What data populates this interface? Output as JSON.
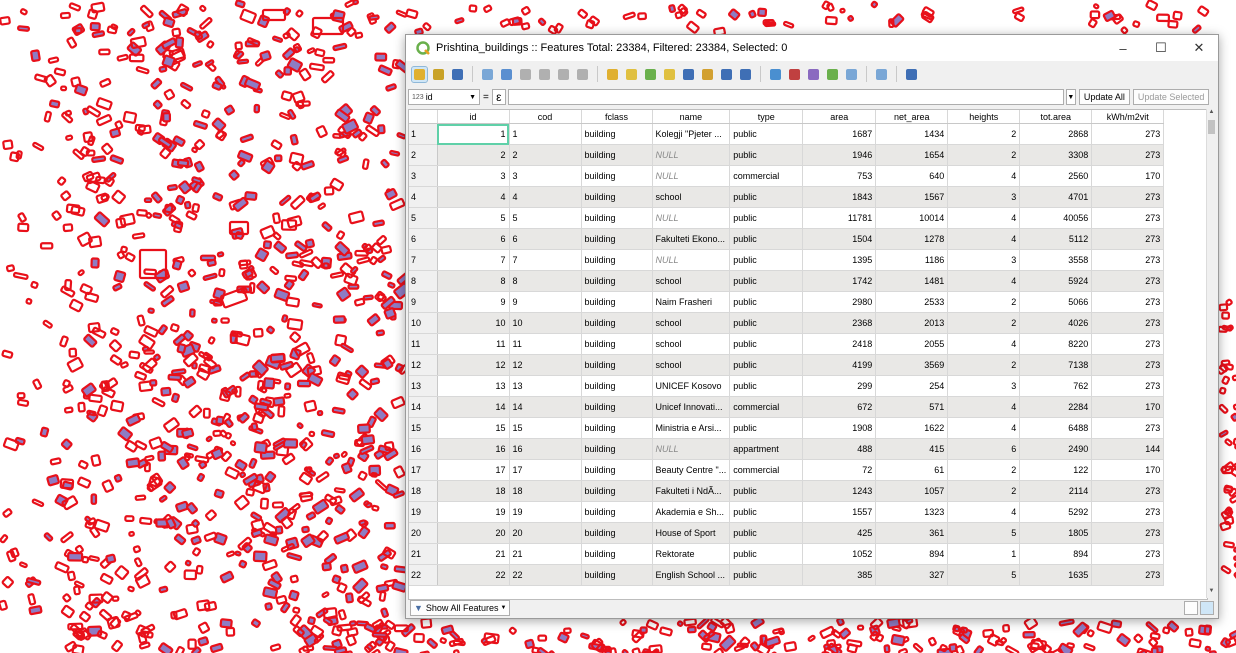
{
  "window": {
    "title": "Prishtina_buildings :: Features Total: 23384, Filtered: 23384, Selected: 0",
    "minimize": "–",
    "maximize": "☐",
    "close": "✕"
  },
  "toolbar": {
    "icons": [
      "pencil-icon",
      "multi-edit-icon",
      "save-icon",
      "reload-icon",
      "add-feature-icon",
      "delete-icon",
      "cut-icon",
      "copy-icon",
      "paste-icon",
      "select-expression-icon",
      "select-all-icon",
      "invert-selection-icon",
      "deselect-icon",
      "filter-icon",
      "move-selection-top-icon",
      "pan-to-selection-icon",
      "zoom-to-selection-icon",
      "new-field-icon",
      "delete-field-icon",
      "field-calculator-icon",
      "conditional-formatting-icon",
      "actions-icon",
      "dock-icon",
      "zoom-map-icon"
    ]
  },
  "expression_bar": {
    "field_select": "id",
    "field_type_label": "123",
    "equals": "=",
    "epsilon": "ε",
    "update_all": "Update All",
    "update_selected": "Update Selected"
  },
  "table": {
    "columns": [
      "id",
      "cod",
      "fclass",
      "name",
      "type",
      "area",
      "net_area",
      "heights",
      "tot.area",
      "kWh/m2vit"
    ],
    "rows": [
      [
        "1",
        "1",
        "1",
        "building",
        "Kolegji \"Pjeter ...",
        "public",
        "1687",
        "1434",
        "2",
        "2868",
        "273"
      ],
      [
        "2",
        "2",
        "2",
        "building",
        "NULL",
        "public",
        "1946",
        "1654",
        "2",
        "3308",
        "273"
      ],
      [
        "3",
        "3",
        "3",
        "building",
        "NULL",
        "commercial",
        "753",
        "640",
        "4",
        "2560",
        "170"
      ],
      [
        "4",
        "4",
        "4",
        "building",
        "school",
        "public",
        "1843",
        "1567",
        "3",
        "4701",
        "273"
      ],
      [
        "5",
        "5",
        "5",
        "building",
        "NULL",
        "public",
        "11781",
        "10014",
        "4",
        "40056",
        "273"
      ],
      [
        "6",
        "6",
        "6",
        "building",
        "Fakulteti Ekono...",
        "public",
        "1504",
        "1278",
        "4",
        "5112",
        "273"
      ],
      [
        "7",
        "7",
        "7",
        "building",
        "NULL",
        "public",
        "1395",
        "1186",
        "3",
        "3558",
        "273"
      ],
      [
        "8",
        "8",
        "8",
        "building",
        "school",
        "public",
        "1742",
        "1481",
        "4",
        "5924",
        "273"
      ],
      [
        "9",
        "9",
        "9",
        "building",
        "Naim Frasheri",
        "public",
        "2980",
        "2533",
        "2",
        "5066",
        "273"
      ],
      [
        "10",
        "10",
        "10",
        "building",
        "school",
        "public",
        "2368",
        "2013",
        "2",
        "4026",
        "273"
      ],
      [
        "11",
        "11",
        "11",
        "building",
        "school",
        "public",
        "2418",
        "2055",
        "4",
        "8220",
        "273"
      ],
      [
        "12",
        "12",
        "12",
        "building",
        "school",
        "public",
        "4199",
        "3569",
        "2",
        "7138",
        "273"
      ],
      [
        "13",
        "13",
        "13",
        "building",
        "UNICEF Kosovo",
        "public",
        "299",
        "254",
        "3",
        "762",
        "273"
      ],
      [
        "14",
        "14",
        "14",
        "building",
        "Unicef Innovati...",
        "commercial",
        "672",
        "571",
        "4",
        "2284",
        "170"
      ],
      [
        "15",
        "15",
        "15",
        "building",
        "Ministria e Arsi...",
        "public",
        "1908",
        "1622",
        "4",
        "6488",
        "273"
      ],
      [
        "16",
        "16",
        "16",
        "building",
        "NULL",
        "appartment",
        "488",
        "415",
        "6",
        "2490",
        "144"
      ],
      [
        "17",
        "17",
        "17",
        "building",
        "Beauty Centre \"...",
        "commercial",
        "72",
        "61",
        "2",
        "122",
        "170"
      ],
      [
        "18",
        "18",
        "18",
        "building",
        "Fakulteti i NdÃ...",
        "public",
        "1243",
        "1057",
        "2",
        "2114",
        "273"
      ],
      [
        "19",
        "19",
        "19",
        "building",
        "Akademia e Sh...",
        "public",
        "1557",
        "1323",
        "4",
        "5292",
        "273"
      ],
      [
        "20",
        "20",
        "20",
        "building",
        "House of Sport",
        "public",
        "425",
        "361",
        "5",
        "1805",
        "273"
      ],
      [
        "21",
        "21",
        "21",
        "building",
        "Rektorate",
        "public",
        "1052",
        "894",
        "1",
        "894",
        "273"
      ],
      [
        "22",
        "22",
        "22",
        "building",
        "English School ...",
        "public",
        "385",
        "327",
        "5",
        "1635",
        "273"
      ]
    ]
  },
  "bottom": {
    "show_all": "Show All Features"
  },
  "colors": {
    "building_outline": "#e8101a",
    "building_fill_selected": "#8e7cc3",
    "selection_outline": "#5fd0a8",
    "alt_row": "#e9e8e6",
    "qgis_green": "#6ab04c"
  }
}
